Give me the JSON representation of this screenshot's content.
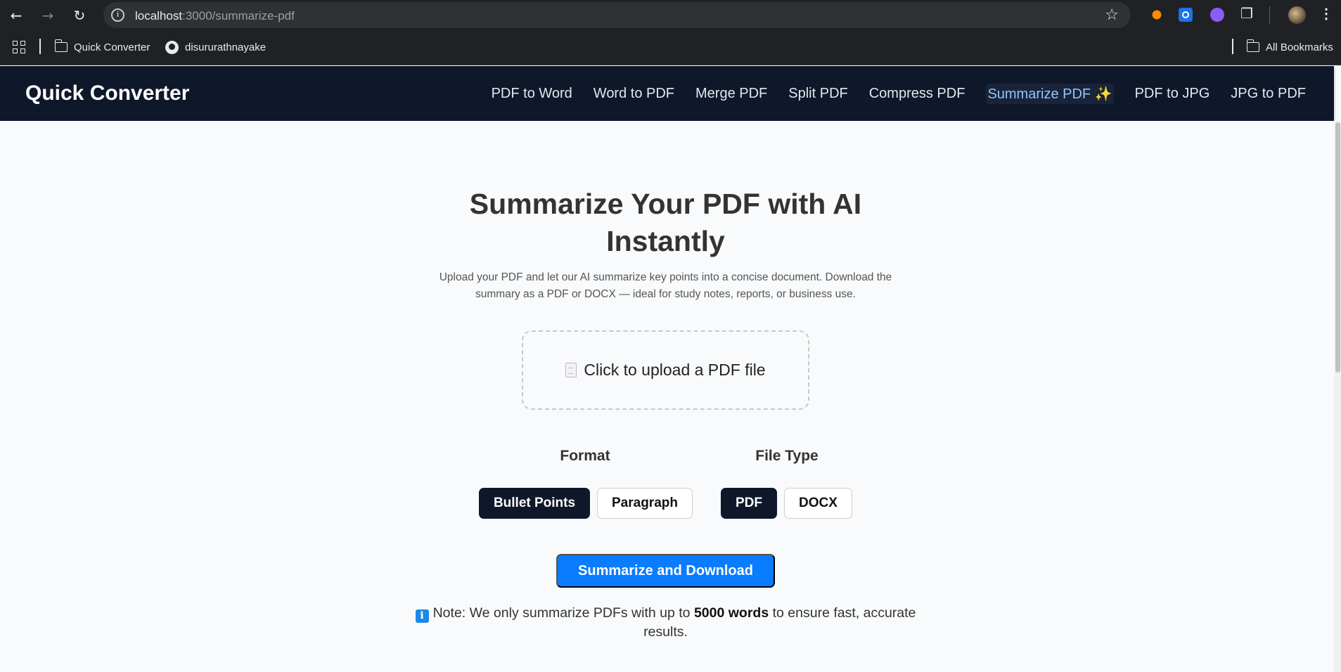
{
  "browser": {
    "url_host": "localhost",
    "url_path": ":3000/summarize-pdf",
    "bookmarks": [
      {
        "label": "Quick Converter"
      },
      {
        "label": "disururathnayake"
      }
    ],
    "all_bookmarks_label": "All Bookmarks"
  },
  "navbar": {
    "brand": "Quick Converter",
    "links": [
      {
        "label": "PDF to Word"
      },
      {
        "label": "Word to PDF"
      },
      {
        "label": "Merge PDF"
      },
      {
        "label": "Split PDF"
      },
      {
        "label": "Compress PDF"
      },
      {
        "label": "Summarize PDF ✨",
        "active": true
      },
      {
        "label": "PDF to JPG"
      },
      {
        "label": "JPG to PDF"
      }
    ],
    "active_color": "#93c5fd",
    "background": "#0f172a"
  },
  "main": {
    "title": "Summarize Your PDF with AI Instantly",
    "description": "Upload your PDF and let our AI summarize key points into a concise document. Download the summary as a PDF or DOCX — ideal for study notes, reports, or business use.",
    "upload_label": "Click to upload a PDF file",
    "format": {
      "label": "Format",
      "options": [
        "Bullet Points",
        "Paragraph"
      ],
      "selected": "Bullet Points"
    },
    "file_type": {
      "label": "File Type",
      "options": [
        "PDF",
        "DOCX"
      ],
      "selected": "PDF"
    },
    "submit_label": "Summarize and Download",
    "submit_color": "#0a7cff",
    "note": {
      "prefix": "Note: We only summarize PDFs with up to",
      "emphasis": "5000 words",
      "suffix": "to ensure fast, accurate results."
    }
  }
}
